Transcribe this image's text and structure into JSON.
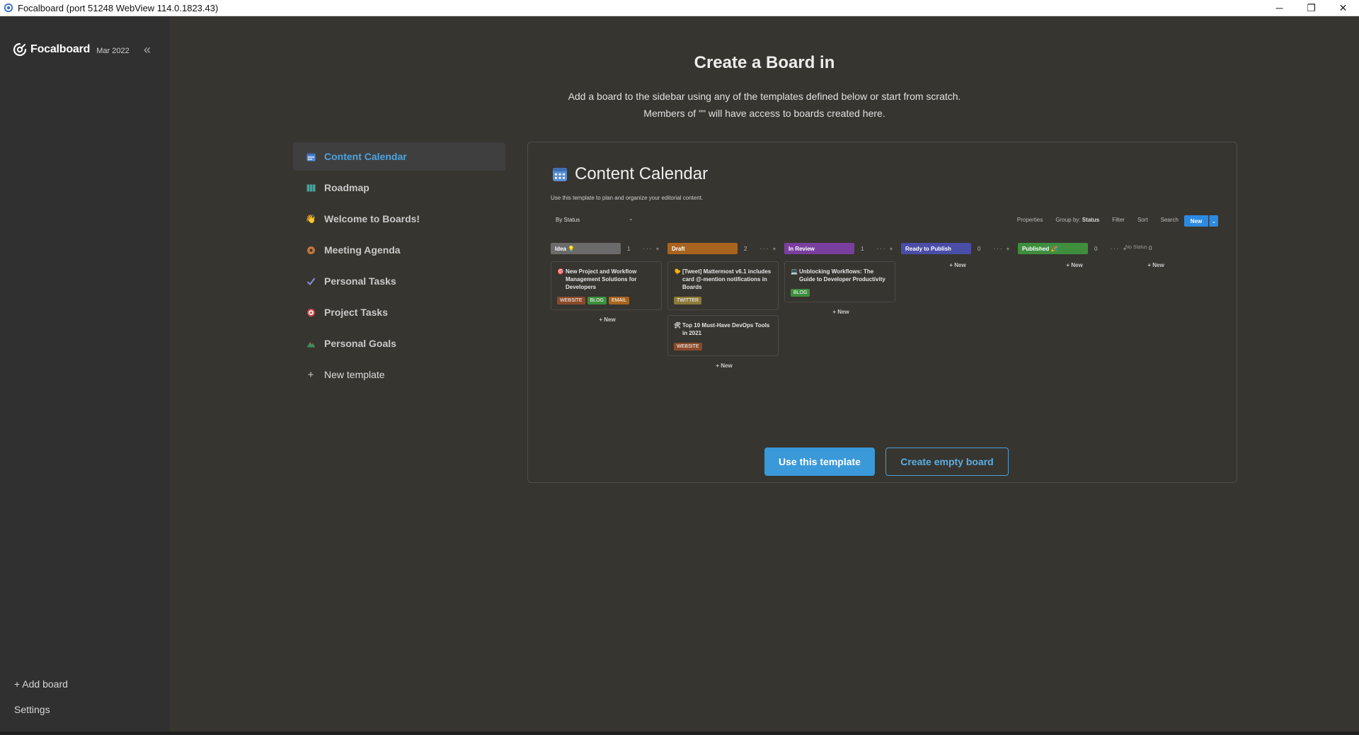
{
  "window": {
    "title": "Focalboard (port 51248 WebView 114.0.1823.43)",
    "minimize": "─",
    "maximize": "❐",
    "close": "✕"
  },
  "sidebar": {
    "brand": "Focalboard",
    "version": "Mar 2022",
    "collapse": "«",
    "add_board": "+ Add board",
    "settings": "Settings"
  },
  "main": {
    "title": "Create a Board in",
    "desc_line1": "Add a board to the sidebar using any of the templates defined below or start from scratch.",
    "desc_line2": "Members of \"\" will have access to boards created here."
  },
  "templates": [
    {
      "label": "Content Calendar",
      "icon": "calendar-icon",
      "active": true
    },
    {
      "label": "Roadmap",
      "icon": "map-icon"
    },
    {
      "label": "Welcome to Boards!",
      "icon": "wave-icon"
    },
    {
      "label": "Meeting Agenda",
      "icon": "donut-icon"
    },
    {
      "label": "Personal Tasks",
      "icon": "check-icon"
    },
    {
      "label": "Project Tasks",
      "icon": "target-icon"
    },
    {
      "label": "Personal Goals",
      "icon": "mountain-icon"
    },
    {
      "label": "New template",
      "icon": "plus-icon"
    }
  ],
  "preview": {
    "title": "Content Calendar",
    "description": "Use this template to plan and organize your editorial content.",
    "view": "By Status",
    "toolbar": {
      "properties": "Properties",
      "group_by_label": "Group by:",
      "group_by_value": "Status",
      "filter": "Filter",
      "sort": "Sort",
      "search": "Search",
      "more": "···",
      "new": "New"
    },
    "columns": [
      {
        "name": "Idea 💡",
        "count": "1",
        "color": "#6b6b6b",
        "cards": [
          {
            "emoji": "🎯",
            "title": "New Project and Workflow Management Solutions for Developers",
            "tags": [
              {
                "label": "WEBSITE",
                "color": "#8a4a2a"
              },
              {
                "label": "BLOG",
                "color": "#3e8e3e"
              },
              {
                "label": "EMAIL",
                "color": "#a8641f"
              }
            ]
          }
        ]
      },
      {
        "name": "Draft",
        "count": "2",
        "color": "#a8641f",
        "cards": [
          {
            "emoji": "🐤",
            "title": "[Tweet] Mattermost v6.1 includes card @-mention notifications in Boards",
            "tags": [
              {
                "label": "TWITTER",
                "color": "#8c7a3c"
              }
            ]
          },
          {
            "emoji": "🛠",
            "title": "Top 10 Must-Have DevOps Tools in 2021",
            "tags": [
              {
                "label": "WEBSITE",
                "color": "#8a4a2a"
              }
            ]
          }
        ]
      },
      {
        "name": "In Review",
        "count": "1",
        "color": "#7a3f9e",
        "cards": [
          {
            "emoji": "💻",
            "title": "Unblocking Workflows: The Guide to Developer Productivity",
            "tags": [
              {
                "label": "BLOG",
                "color": "#3e8e3e"
              }
            ]
          }
        ]
      },
      {
        "name": "Ready to Publish",
        "count": "0",
        "color": "#4a4ea8",
        "cards": []
      },
      {
        "name": "Published 🎉",
        "count": "0",
        "color": "#3e8e3e",
        "cards": []
      }
    ],
    "col_actions": "··· +",
    "add_new": "+ New",
    "no_status": "No Status",
    "no_status_count": "0"
  },
  "buttons": {
    "use_template": "Use this template",
    "create_empty": "Create empty board"
  }
}
